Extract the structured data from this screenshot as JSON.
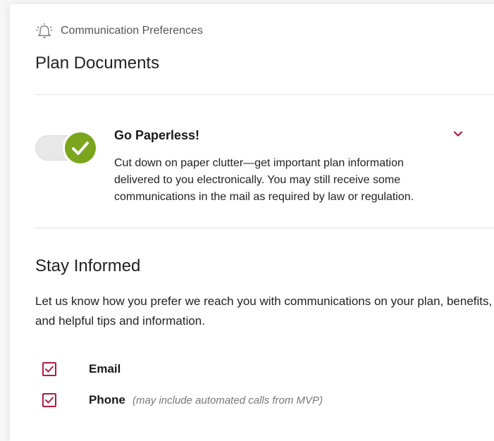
{
  "header": {
    "eyebrow": "Communication Preferences",
    "eyebrow_icon": "bell-icon",
    "title": "Plan Documents"
  },
  "paperless": {
    "toggle_on": true,
    "title": "Go Paperless!",
    "description": "Cut down on paper clutter—get important plan information delivered to you electronically. You may still receive some communications in the mail as required by law or regulation.",
    "expand_icon": "chevron-down-icon"
  },
  "stay_informed": {
    "title": "Stay Informed",
    "description": "Let us know how you prefer we reach you with communications on your plan, benefits, and helpful tips and information.",
    "options": [
      {
        "label": "Email",
        "checked": true,
        "note": ""
      },
      {
        "label": "Phone",
        "checked": true,
        "note": "(may include automated calls from MVP)"
      }
    ]
  },
  "colors": {
    "accent": "#b31942",
    "toggle_on": "#7aa51c",
    "text": "#222222",
    "muted": "#777777"
  }
}
